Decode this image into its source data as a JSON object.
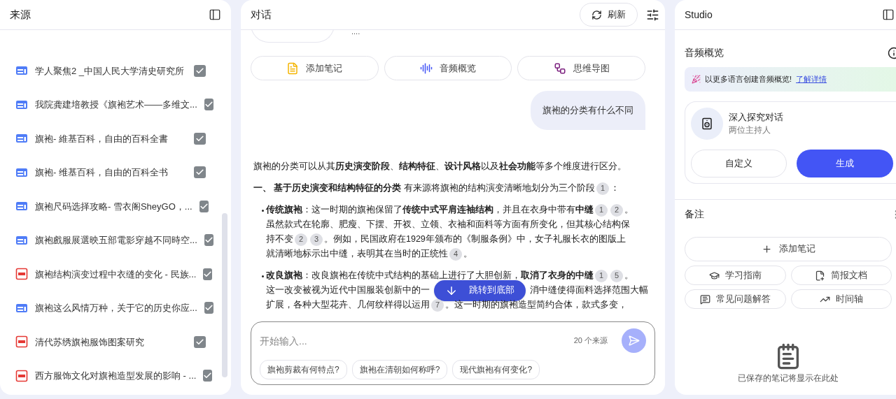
{
  "sources": {
    "title": "来源",
    "items": [
      {
        "kind": "web",
        "title": "学人聚焦2 _中国人民大学清史研究所",
        "checked": true
      },
      {
        "kind": "web",
        "title": "我院龚建培教授《旗袍艺术——多维文...",
        "checked": true
      },
      {
        "kind": "web",
        "title": "旗袍- 維基百科，自由的百科全書",
        "checked": true
      },
      {
        "kind": "web",
        "title": "旗袍- 维基百科，自由的百科全书",
        "checked": true
      },
      {
        "kind": "web",
        "title": "旗袍尺码选择攻略- 雪衣阁SheyGO，...",
        "checked": true
      },
      {
        "kind": "web",
        "title": "旗袍戲服展選映五部電影穿越不同時空...",
        "checked": true
      },
      {
        "kind": "pdf",
        "title": "旗袍结构演变过程中衣缝的变化 - 民族...",
        "checked": true
      },
      {
        "kind": "web",
        "title": "旗袍这么风情万种，关于它的历史你应...",
        "checked": true
      },
      {
        "kind": "pdf",
        "title": "清代苏绣旗袍服饰图案研究",
        "checked": true
      },
      {
        "kind": "pdf",
        "title": "西方服饰文化对旗袍造型发展的影响 - ...",
        "checked": true
      }
    ]
  },
  "chat": {
    "title": "对话",
    "refresh": "刷新",
    "ellipsis": "....",
    "actions": [
      {
        "kind": "note",
        "label": "添加笔记"
      },
      {
        "kind": "audio",
        "label": "音频概览"
      },
      {
        "kind": "mindmap",
        "label": "思维导图"
      }
    ],
    "question": "旗袍的分类有什么不同",
    "intro": "旗袍的分类可以从其**历史演变阶段**、**结构特征**、**设计风格**以及**社会功能**等多个维度进行区分。",
    "heading": {
      "number": "一、",
      "title": "基于历史演变和结构特征的分类",
      "parts": [
        {
          "kind": "text",
          "text": " 有来源将旗袍的结构演变清晰地划分为三个阶段"
        },
        {
          "kind": "cite",
          "text": "1"
        },
        {
          "kind": "text",
          "text": "："
        }
      ]
    },
    "bullets": [
      {
        "label": "传统旗袍",
        "parts": [
          {
            "kind": "text",
            "text": "：这一时期的旗袍保留了**传统中式平肩连袖结构**，并且在衣身中带有**中缝**"
          },
          {
            "kind": "cite",
            "text": "1"
          },
          {
            "kind": "cite",
            "text": "2"
          },
          {
            "kind": "text",
            "text": "。虽然款式在轮廓、肥瘦、下摆、开衩、立领、衣袖和面料等方面有所变化，但其核心结构保持不变"
          },
          {
            "kind": "cite",
            "text": "2"
          },
          {
            "kind": "cite",
            "text": "3"
          },
          {
            "kind": "text",
            "text": "。例如，民国政府在1929年颁布的《制服条例》中，女子礼服长衣的图版上就清晰地标示出中缝，表明其在当时的正统性"
          },
          {
            "kind": "cite",
            "text": "4"
          },
          {
            "kind": "text",
            "text": "。"
          }
        ]
      },
      {
        "label": "改良旗袍",
        "lines": [
          [
            {
              "kind": "text",
              "text": "：改良旗袍在传统中式结构的基础上进行了大胆创新，**取消了衣身的中缝**"
            },
            {
              "kind": "cite",
              "text": "1"
            },
            {
              "kind": "cite",
              "text": "5"
            },
            {
              "kind": "text",
              "text": "。"
            }
          ],
          [
            {
              "kind": "text",
              "text": "这一改变被视为近代中国服装创新中的一"
            },
            {
              "kind": "jump",
              "text": "跳转到底部"
            },
            {
              "kind": "text",
              "text": "消中缝使得面料选择范围大幅"
            }
          ],
          [
            {
              "kind": "text",
              "text": "扩展，各种大型花卉、几何纹样得以运用"
            },
            {
              "kind": "cite",
              "text": "7"
            },
            {
              "kind": "text",
              "text": "。这一时期的旗袍造型简约合体，款式多变，"
            }
          ]
        ]
      }
    ],
    "input": {
      "placeholder": "开始输入...",
      "count": "20 个来源"
    },
    "suggestions": [
      "旗袍剪裁有何特点?",
      "旗袍在清朝如何称呼?",
      "现代旗袍有何变化?"
    ]
  },
  "studio": {
    "title": "Studio",
    "audio": {
      "title": "音频概览",
      "banner": "以更多语言创建音频概览!",
      "banner_link": "了解详情",
      "card_title": "深入探究对话",
      "card_subtitle": "两位主持人",
      "customize": "自定义",
      "generate": "生成"
    },
    "notes": {
      "title": "备注",
      "add": "添加笔记",
      "tools": [
        {
          "kind": "guide",
          "label": "学习指南"
        },
        {
          "kind": "brief",
          "label": "简报文档"
        },
        {
          "kind": "faq",
          "label": "常见问题解答"
        },
        {
          "kind": "timeline",
          "label": "时间轴"
        }
      ],
      "empty": "已保存的笔记将显示在此处"
    }
  }
}
